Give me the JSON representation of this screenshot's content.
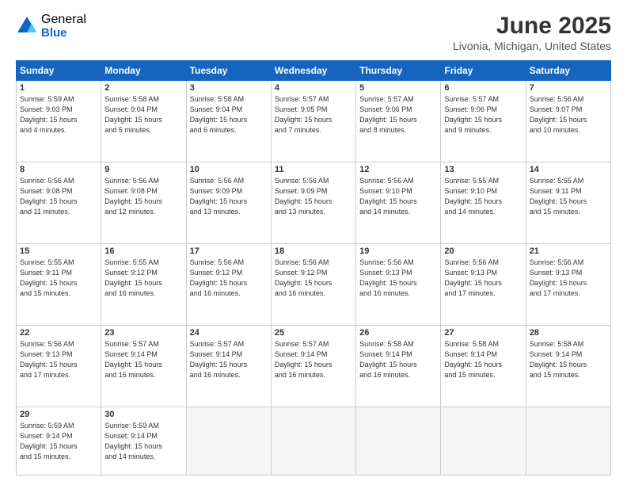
{
  "header": {
    "logo_general": "General",
    "logo_blue": "Blue",
    "title": "June 2025",
    "location": "Livonia, Michigan, United States"
  },
  "days_of_week": [
    "Sunday",
    "Monday",
    "Tuesday",
    "Wednesday",
    "Thursday",
    "Friday",
    "Saturday"
  ],
  "weeks": [
    [
      {
        "day": "1",
        "info": "Sunrise: 5:59 AM\nSunset: 9:03 PM\nDaylight: 15 hours\nand 4 minutes."
      },
      {
        "day": "2",
        "info": "Sunrise: 5:58 AM\nSunset: 9:04 PM\nDaylight: 15 hours\nand 5 minutes."
      },
      {
        "day": "3",
        "info": "Sunrise: 5:58 AM\nSunset: 9:04 PM\nDaylight: 15 hours\nand 6 minutes."
      },
      {
        "day": "4",
        "info": "Sunrise: 5:57 AM\nSunset: 9:05 PM\nDaylight: 15 hours\nand 7 minutes."
      },
      {
        "day": "5",
        "info": "Sunrise: 5:57 AM\nSunset: 9:06 PM\nDaylight: 15 hours\nand 8 minutes."
      },
      {
        "day": "6",
        "info": "Sunrise: 5:57 AM\nSunset: 9:06 PM\nDaylight: 15 hours\nand 9 minutes."
      },
      {
        "day": "7",
        "info": "Sunrise: 5:56 AM\nSunset: 9:07 PM\nDaylight: 15 hours\nand 10 minutes."
      }
    ],
    [
      {
        "day": "8",
        "info": "Sunrise: 5:56 AM\nSunset: 9:08 PM\nDaylight: 15 hours\nand 11 minutes."
      },
      {
        "day": "9",
        "info": "Sunrise: 5:56 AM\nSunset: 9:08 PM\nDaylight: 15 hours\nand 12 minutes."
      },
      {
        "day": "10",
        "info": "Sunrise: 5:56 AM\nSunset: 9:09 PM\nDaylight: 15 hours\nand 13 minutes."
      },
      {
        "day": "11",
        "info": "Sunrise: 5:56 AM\nSunset: 9:09 PM\nDaylight: 15 hours\nand 13 minutes."
      },
      {
        "day": "12",
        "info": "Sunrise: 5:56 AM\nSunset: 9:10 PM\nDaylight: 15 hours\nand 14 minutes."
      },
      {
        "day": "13",
        "info": "Sunrise: 5:55 AM\nSunset: 9:10 PM\nDaylight: 15 hours\nand 14 minutes."
      },
      {
        "day": "14",
        "info": "Sunrise: 5:55 AM\nSunset: 9:11 PM\nDaylight: 15 hours\nand 15 minutes."
      }
    ],
    [
      {
        "day": "15",
        "info": "Sunrise: 5:55 AM\nSunset: 9:11 PM\nDaylight: 15 hours\nand 15 minutes."
      },
      {
        "day": "16",
        "info": "Sunrise: 5:55 AM\nSunset: 9:12 PM\nDaylight: 15 hours\nand 16 minutes."
      },
      {
        "day": "17",
        "info": "Sunrise: 5:56 AM\nSunset: 9:12 PM\nDaylight: 15 hours\nand 16 minutes."
      },
      {
        "day": "18",
        "info": "Sunrise: 5:56 AM\nSunset: 9:12 PM\nDaylight: 15 hours\nand 16 minutes."
      },
      {
        "day": "19",
        "info": "Sunrise: 5:56 AM\nSunset: 9:13 PM\nDaylight: 15 hours\nand 16 minutes."
      },
      {
        "day": "20",
        "info": "Sunrise: 5:56 AM\nSunset: 9:13 PM\nDaylight: 15 hours\nand 17 minutes."
      },
      {
        "day": "21",
        "info": "Sunrise: 5:56 AM\nSunset: 9:13 PM\nDaylight: 15 hours\nand 17 minutes."
      }
    ],
    [
      {
        "day": "22",
        "info": "Sunrise: 5:56 AM\nSunset: 9:13 PM\nDaylight: 15 hours\nand 17 minutes."
      },
      {
        "day": "23",
        "info": "Sunrise: 5:57 AM\nSunset: 9:14 PM\nDaylight: 15 hours\nand 16 minutes."
      },
      {
        "day": "24",
        "info": "Sunrise: 5:57 AM\nSunset: 9:14 PM\nDaylight: 15 hours\nand 16 minutes."
      },
      {
        "day": "25",
        "info": "Sunrise: 5:57 AM\nSunset: 9:14 PM\nDaylight: 15 hours\nand 16 minutes."
      },
      {
        "day": "26",
        "info": "Sunrise: 5:58 AM\nSunset: 9:14 PM\nDaylight: 15 hours\nand 16 minutes."
      },
      {
        "day": "27",
        "info": "Sunrise: 5:58 AM\nSunset: 9:14 PM\nDaylight: 15 hours\nand 15 minutes."
      },
      {
        "day": "28",
        "info": "Sunrise: 5:58 AM\nSunset: 9:14 PM\nDaylight: 15 hours\nand 15 minutes."
      }
    ],
    [
      {
        "day": "29",
        "info": "Sunrise: 5:59 AM\nSunset: 9:14 PM\nDaylight: 15 hours\nand 15 minutes."
      },
      {
        "day": "30",
        "info": "Sunrise: 5:59 AM\nSunset: 9:14 PM\nDaylight: 15 hours\nand 14 minutes."
      },
      {
        "day": "",
        "info": ""
      },
      {
        "day": "",
        "info": ""
      },
      {
        "day": "",
        "info": ""
      },
      {
        "day": "",
        "info": ""
      },
      {
        "day": "",
        "info": ""
      }
    ]
  ]
}
